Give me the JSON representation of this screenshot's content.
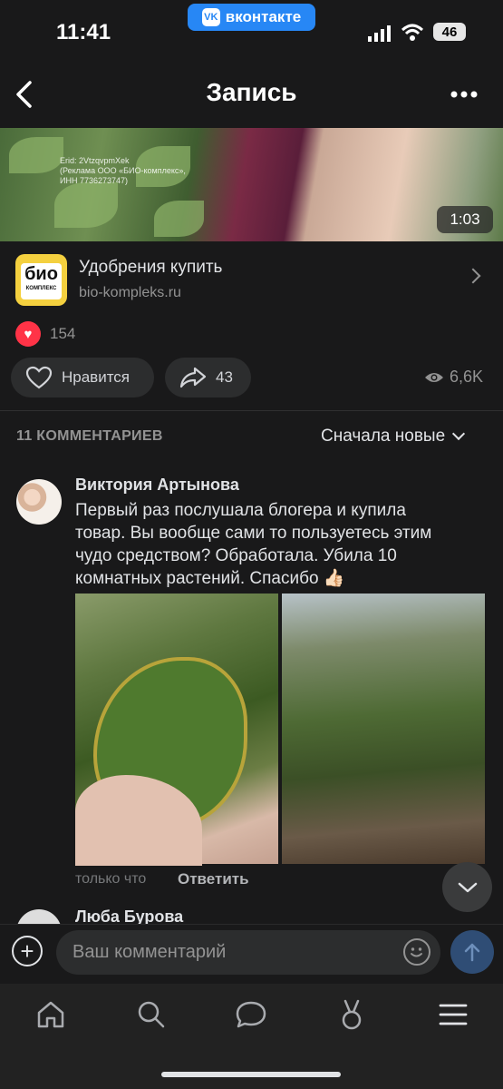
{
  "status_bar": {
    "time": "11:41",
    "app_pill": "вконтакте",
    "vk_logo": "VK",
    "battery": "46"
  },
  "header": {
    "title": "Запись",
    "back_icon": "chevron-left-icon",
    "more_icon": "more-horizontal-icon"
  },
  "video": {
    "duration": "1:03",
    "overlay_lines": [
      "Erid: 2VtzqvpmXek",
      "(Реклама ООО «БИО-комплекс»,",
      "ИНН 7736273747)"
    ]
  },
  "ad": {
    "logo_text": "био",
    "logo_subtext": "КОМПЛЕКС",
    "title": "Удобрения купить",
    "domain": "bio-kompleks.ru"
  },
  "reactions": {
    "count": "154",
    "like_label": "Нравится",
    "share_count": "43",
    "views": "6,6K"
  },
  "comments_header": {
    "count_label": "11 КОММЕНТАРИЕВ",
    "sort_label": "Сначала новые"
  },
  "comments": [
    {
      "author": "Виктория Артынова",
      "text": "Первый раз послушала блогера и купила товар. Вы вообще сами то пользуетесь этим чудо средством? Обработала. Убила 10 комнатных растений. Спасибо 👍🏻",
      "time": "только что",
      "reply_label": "Ответить"
    },
    {
      "author": "Люба Бурова"
    }
  ],
  "composer": {
    "placeholder": "Ваш комментарий"
  },
  "tabbar": {
    "items": [
      "home-icon",
      "search-icon",
      "messages-icon",
      "clips-icon",
      "menu-icon"
    ]
  },
  "colors": {
    "background": "#19191a",
    "accent": "#2787f5",
    "like_red": "#ff3347",
    "muted_text": "#939393"
  }
}
